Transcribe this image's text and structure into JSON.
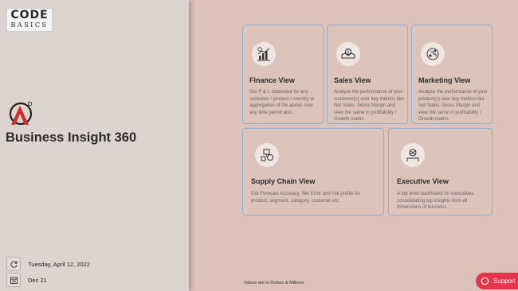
{
  "logo": {
    "line1": "CODE",
    "line2": "BASICS"
  },
  "app": {
    "title": "Business Insight 360"
  },
  "sidebar": {
    "refresh_date": "Tuesday, April 12, 2022",
    "data_upto": "Dec 21"
  },
  "cards": {
    "finance": {
      "title": "Finance View",
      "description": "Get P & L statement for any customer / product / country or aggregation of the above over any time period and...",
      "icon": "finance-chart-icon"
    },
    "sales": {
      "title": "Sales View",
      "description": "Analyze the performance of your customer(s) over key metrics like Net Sales, Gross Margin and view the same in profitability / Growth matrix.",
      "icon": "sales-icon"
    },
    "marketing": {
      "title": "Marketing View",
      "description": "Analyze the performance of your product(s) over key metrics like Net Sales, Gross Margin and view the same in profitability / Growth matrix.",
      "icon": "marketing-icon"
    },
    "supply_chain": {
      "title": "Supply Chain View",
      "description": "Get Forecast Accuracy, Net Error and risk profile for product, segment, category, customer etc.",
      "icon": "supply-chain-icon"
    },
    "executive": {
      "title": "Executive View",
      "description": "A top level dashboard for executives consolidating top insights from all dimensions of business.",
      "icon": "executive-icon"
    }
  },
  "footer": {
    "note": "Values are in Dollars & Millions"
  },
  "support": {
    "label": "Support"
  },
  "colors": {
    "accent": "#e8344a",
    "card_border": "#8ab0d8",
    "brand_red": "#d32b2b"
  }
}
